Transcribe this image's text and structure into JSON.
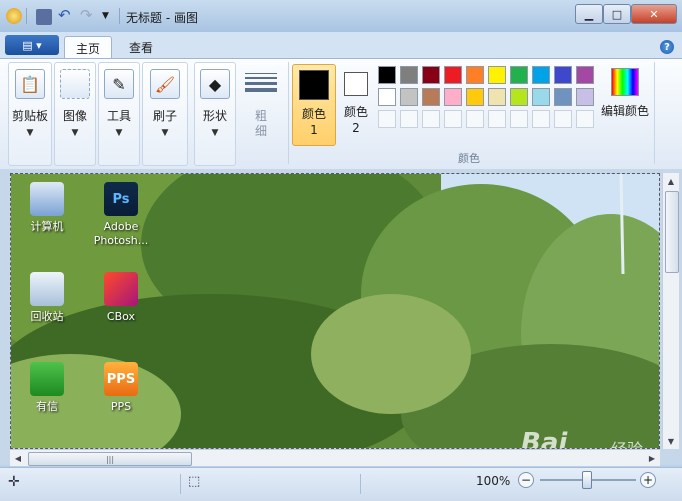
{
  "window": {
    "title": "无标题 - 画图"
  },
  "tabs": [
    {
      "label": "主页"
    },
    {
      "label": "查看"
    }
  ],
  "ribbon": {
    "groups": [
      {
        "label": "剪贴板"
      },
      {
        "label": "图像"
      },
      {
        "label": "工具"
      },
      {
        "label": "刷子"
      },
      {
        "label": "形状"
      }
    ],
    "size_label": "粗细",
    "color1_label": "颜色 1",
    "color2_label": "颜色 2",
    "edit_colors_label": "编辑颜色",
    "colors_group_label": "颜色",
    "color1": "#000000",
    "color2": "#ffffff",
    "palette_row1": [
      "#000000",
      "#7f7f7f",
      "#880015",
      "#ed1c24",
      "#ff7f27",
      "#fff200",
      "#22b14c",
      "#00a2e8",
      "#3f48cc",
      "#a349a4"
    ],
    "palette_row2": [
      "#ffffff",
      "#c3c3c3",
      "#b97a57",
      "#ffaec9",
      "#ffc90e",
      "#efe4b0",
      "#b5e61d",
      "#99d9ea",
      "#7092be",
      "#c8bfe7"
    ]
  },
  "desktop_icons": [
    {
      "label": "计算机",
      "icon": "computer-icon"
    },
    {
      "label": "Adobe Photosh...",
      "icon": "photoshop-icon",
      "badge": "Ps"
    },
    {
      "label": "回收站",
      "icon": "recycle-bin-icon"
    },
    {
      "label": "CBox",
      "icon": "cbox-icon"
    },
    {
      "label": "有信",
      "icon": "youxin-icon"
    },
    {
      "label": "PPS",
      "icon": "pps-icon",
      "badge": "PPS"
    }
  ],
  "status": {
    "zoom": "100%"
  },
  "watermark": {
    "text": "Bai",
    "sub": "经验"
  }
}
